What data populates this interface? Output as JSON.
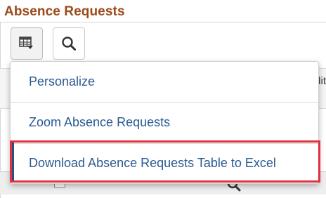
{
  "page": {
    "title": "Absence Requests"
  },
  "toolbar": {
    "grid_button_icon": "grid-menu-icon",
    "search_button_icon": "search-icon"
  },
  "grid": {
    "peek_text": "dit"
  },
  "menu": {
    "items": [
      {
        "label": "Personalize"
      },
      {
        "label": "Zoom Absence Requests"
      },
      {
        "label": "Download Absence Requests Table to Excel",
        "highlighted": true
      }
    ]
  },
  "colors": {
    "title": "#9b4a1a",
    "menu_text": "#2a5b93",
    "highlight_border": "#e0323e"
  }
}
